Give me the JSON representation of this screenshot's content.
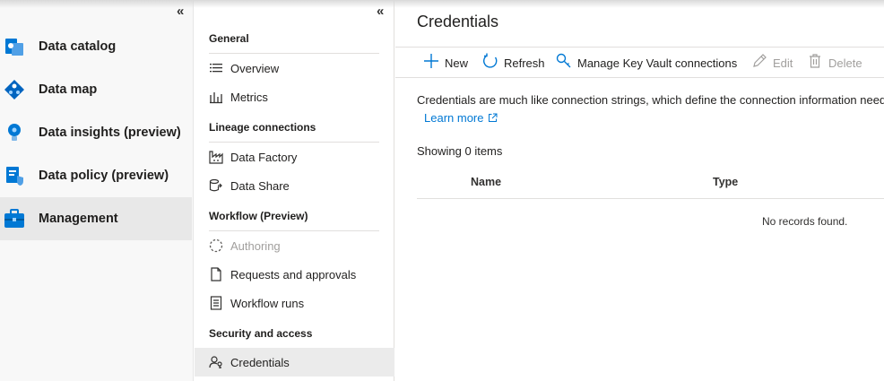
{
  "left_nav": {
    "collapse_glyph": "«",
    "items": [
      {
        "label": "Data catalog",
        "icon": "data-catalog-icon"
      },
      {
        "label": "Data map",
        "icon": "data-map-icon"
      },
      {
        "label": "Data insights (preview)",
        "icon": "data-insights-icon"
      },
      {
        "label": "Data policy (preview)",
        "icon": "data-policy-icon"
      },
      {
        "label": "Management",
        "icon": "management-icon",
        "active": true
      }
    ]
  },
  "menu": {
    "collapse_glyph": "«",
    "sections": [
      {
        "header": "General",
        "items": [
          {
            "label": "Overview",
            "icon": "list-icon"
          },
          {
            "label": "Metrics",
            "icon": "metrics-icon"
          }
        ]
      },
      {
        "header": "Lineage connections",
        "items": [
          {
            "label": "Data Factory",
            "icon": "data-factory-icon"
          },
          {
            "label": "Data Share",
            "icon": "data-share-icon"
          }
        ]
      },
      {
        "header": "Workflow (Preview)",
        "items": [
          {
            "label": "Authoring",
            "icon": "authoring-icon",
            "disabled": true
          },
          {
            "label": "Requests and approvals",
            "icon": "document-icon"
          },
          {
            "label": "Workflow runs",
            "icon": "checklist-icon"
          }
        ]
      },
      {
        "header": "Security and access",
        "items": [
          {
            "label": "Credentials",
            "icon": "credentials-icon",
            "active": true
          }
        ]
      }
    ]
  },
  "main": {
    "title": "Credentials",
    "commands": {
      "new": "New",
      "refresh": "Refresh",
      "manage_key_vault": "Manage Key Vault connections",
      "edit": "Edit",
      "delete": "Delete"
    },
    "description": "Credentials are much like connection strings, which define the connection information needed",
    "learn_more": "Learn more",
    "showing": "Showing 0 items",
    "columns": {
      "name": "Name",
      "type": "Type"
    },
    "empty_message": "No records found."
  },
  "colors": {
    "accent": "#0078d4",
    "disabled": "#a19f9d",
    "active_bg": "#e8e8e8"
  }
}
